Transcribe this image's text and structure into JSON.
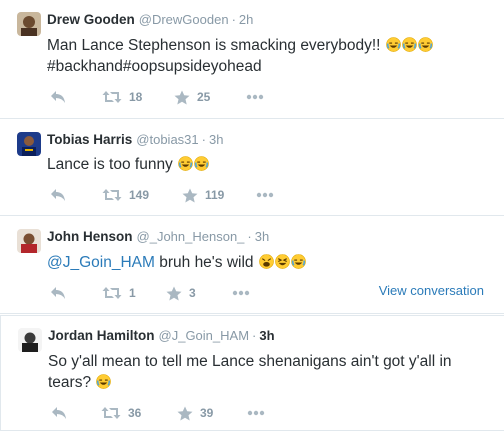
{
  "tweets": [
    {
      "name": "Drew Gooden",
      "handle": "@DrewGooden",
      "separator": "·",
      "time": "2h",
      "text": "Man Lance Stephenson is smacking everybody!!",
      "text_line2": "#backhand#oopsupsideyohead",
      "emojis": [
        "joy-emoji",
        "joy-emoji",
        "joy-emoji"
      ],
      "retweets": "18",
      "favorites": "25",
      "avatar_color": "#6b4a2f"
    },
    {
      "name": "Tobias Harris",
      "handle": "@tobias31",
      "separator": "·",
      "time": "3h",
      "text": "Lance is too funny",
      "emojis": [
        "joy-emoji",
        "joy-emoji"
      ],
      "retweets": "149",
      "favorites": "119",
      "avatar_color": "#1d3b8a"
    },
    {
      "name": "John Henson",
      "handle": "@_John_Henson_",
      "separator": "·",
      "time": "3h",
      "mention": "@J_Goin_HAM",
      "text": "bruh he's wild",
      "emojis": [
        "weary-emoji",
        "grin-squint-emoji",
        "joy-emoji"
      ],
      "retweets": "1",
      "favorites": "3",
      "view_conversation": "View conversation",
      "avatar_color": "#b3262b"
    },
    {
      "name": "Jordan Hamilton",
      "handle": "@J_Goin_HAM",
      "separator": "·",
      "time": "3h",
      "text": "So y'all mean to tell me Lance shenanigans ain't got y'all in",
      "text_line2": "tears?",
      "emojis": [
        "joy-emoji"
      ],
      "retweets": "36",
      "favorites": "39",
      "avatar_color": "#3a3a3a"
    }
  ],
  "colors": {
    "text": "#292f33",
    "muted": "#8899a6",
    "link": "#2b7bb9",
    "border": "#e1e8ed",
    "icon": "#aab8c2"
  }
}
